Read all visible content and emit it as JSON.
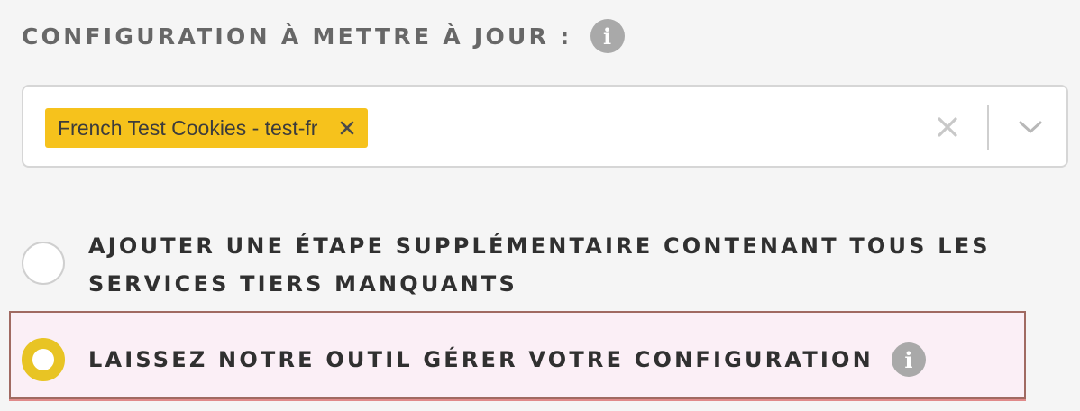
{
  "config_section": {
    "title": "CONFIGURATION À METTRE À JOUR :",
    "info_icon": "i"
  },
  "config_select": {
    "selected_chips": [
      {
        "label": "French Test Cookies - test-fr"
      }
    ],
    "clear_icon": "close-icon",
    "dropdown_icon": "chevron-down-icon"
  },
  "update_options": [
    {
      "label": "AJOUTER UNE ÉTAPE SUPPLÉMENTAIRE CONTENANT TOUS LES SERVICES TIERS MANQUANTS",
      "selected": false
    },
    {
      "label": "LAISSEZ NOTRE OUTIL GÉRER VOTRE CONFIGURATION",
      "selected": true,
      "info_icon": "i"
    }
  ],
  "colors": {
    "accent": "#f6c21c",
    "radio_selected": "#e8c424",
    "highlight_border": "#a06a62",
    "highlight_background": "#fbeff6"
  }
}
